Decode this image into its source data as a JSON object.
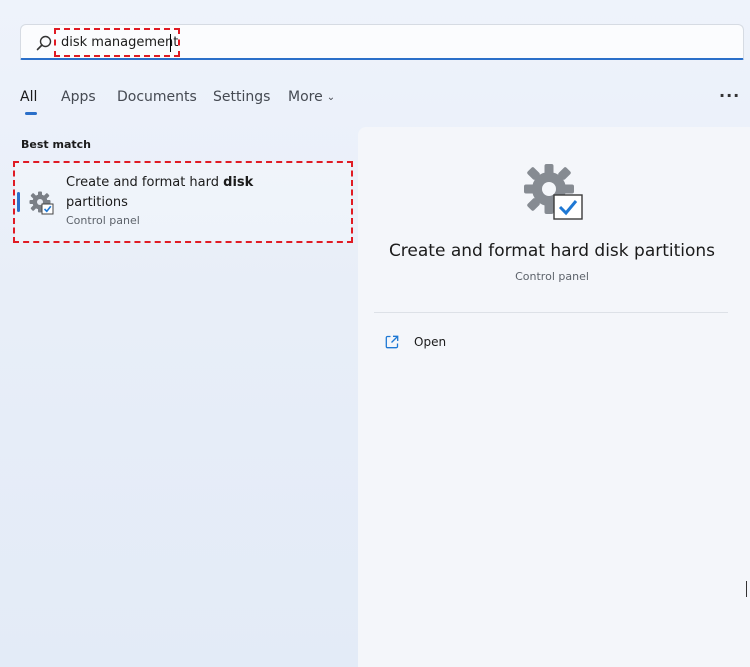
{
  "search": {
    "value": "disk management"
  },
  "tabs": [
    {
      "label": "All"
    },
    {
      "label": "Apps"
    },
    {
      "label": "Documents"
    },
    {
      "label": "Settings"
    },
    {
      "label": "More"
    }
  ],
  "best_match": {
    "section_label": "Best match",
    "title_prefix": "Create and format hard ",
    "title_bold": "disk",
    "title_suffix": " partitions",
    "subtitle": "Control panel"
  },
  "detail": {
    "title": "Create and format hard disk partitions",
    "subtitle": "Control panel",
    "actions": [
      {
        "label": "Open",
        "icon": "open-external-icon"
      }
    ]
  },
  "colors": {
    "accent": "#2a6fc9",
    "highlight": "#e01b24"
  }
}
